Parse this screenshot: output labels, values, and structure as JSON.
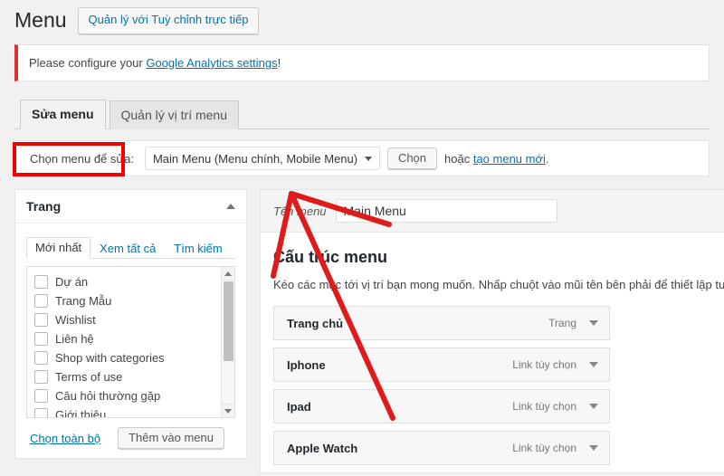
{
  "header": {
    "title": "Menu",
    "customize_button": "Quản lý với Tuỳ chỉnh trực tiếp"
  },
  "notice": {
    "text_before": "Please configure your ",
    "link": "Google Analytics settings",
    "text_after": "!"
  },
  "tabs": [
    {
      "label": "Sửa menu",
      "active": true
    },
    {
      "label": "Quản lý vị trí menu",
      "active": false
    }
  ],
  "select_bar": {
    "label": "Chọn menu để sửa:",
    "selected_menu": "Main Menu (Menu chính, Mobile Menu)",
    "select_button": "Chọn",
    "or_text": "hoặc ",
    "or_link": "tạo menu mới",
    "or_suffix": "."
  },
  "left_panel": {
    "title": "Trang",
    "tabs": [
      {
        "label": "Mới nhất",
        "active": true
      },
      {
        "label": "Xem tất cả",
        "active": false
      },
      {
        "label": "Tìm kiếm",
        "active": false
      }
    ],
    "items": [
      "Dự án",
      "Trang Mẫu",
      "Wishlist",
      "Liên hệ",
      "Shop with categories",
      "Terms of use",
      "Câu hỏi thường gặp",
      "Giới thiệu"
    ],
    "select_all_link": "Chọn toàn bộ",
    "add_to_menu_button": "Thêm vào menu"
  },
  "right_panel": {
    "menu_name_label": "Tên menu",
    "menu_name_value": "Main Menu",
    "structure_title": "Cấu trúc menu",
    "structure_description": "Kéo các mục tới vị trí bạn mong muốn. Nhấp chuột vào mũi tên bên phải để thiết lập tuỳ chỉnh cho",
    "menu_items": [
      {
        "title": "Trang chủ",
        "type": "Trang"
      },
      {
        "title": "Iphone",
        "type": "Link tùy chọn"
      },
      {
        "title": "Ipad",
        "type": "Link tùy chọn"
      },
      {
        "title": "Apple Watch",
        "type": "Link tùy chọn"
      }
    ]
  },
  "annotations": {
    "highlight_color": "#f40000",
    "arrow_color": "#e01b1b"
  }
}
